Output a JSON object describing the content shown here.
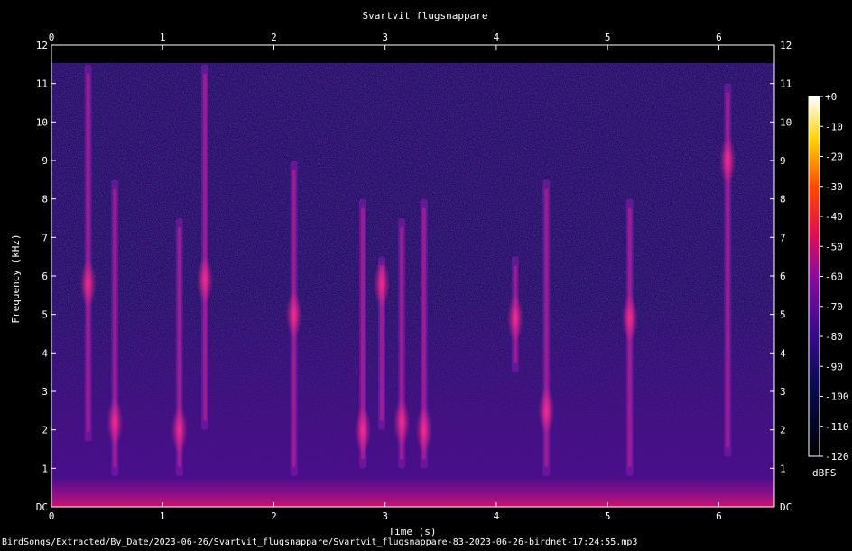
{
  "chart_data": {
    "type": "heatmap",
    "title": "Svartvit flugsnappare",
    "xlabel": "Time (s)",
    "ylabel": "Frequency (kHz)",
    "xlim": [
      0,
      6.5
    ],
    "ylim": [
      0,
      12
    ],
    "x_ticks": [
      "0",
      "1",
      "2",
      "3",
      "4",
      "5",
      "6"
    ],
    "y_ticks": [
      "DC",
      "1",
      "2",
      "3",
      "4",
      "5",
      "6",
      "7",
      "8",
      "9",
      "10",
      "11",
      "12"
    ],
    "colorbar": {
      "label": "dBFS",
      "range": [
        -120,
        0
      ],
      "ticks": [
        "+0",
        "-10",
        "-20",
        "-30",
        "-40",
        "-50",
        "-60",
        "-70",
        "-80",
        "-90",
        "-100",
        "-110",
        "-120"
      ]
    },
    "calls": [
      {
        "t": 0.33,
        "f_min": 1.7,
        "f_max": 11.5,
        "peak_khz": 5.8
      },
      {
        "t": 0.57,
        "f_min": 0.8,
        "f_max": 8.5,
        "peak_khz": 2.2
      },
      {
        "t": 1.15,
        "f_min": 0.8,
        "f_max": 7.5,
        "peak_khz": 2.0
      },
      {
        "t": 1.38,
        "f_min": 2.0,
        "f_max": 11.5,
        "peak_khz": 5.9
      },
      {
        "t": 2.18,
        "f_min": 0.8,
        "f_max": 9.0,
        "peak_khz": 5.0
      },
      {
        "t": 2.8,
        "f_min": 1.0,
        "f_max": 8.0,
        "peak_khz": 2.0
      },
      {
        "t": 2.97,
        "f_min": 2.0,
        "f_max": 6.5,
        "peak_khz": 5.8
      },
      {
        "t": 3.15,
        "f_min": 1.0,
        "f_max": 7.5,
        "peak_khz": 2.2
      },
      {
        "t": 3.35,
        "f_min": 1.0,
        "f_max": 8.0,
        "peak_khz": 2.0
      },
      {
        "t": 4.17,
        "f_min": 3.5,
        "f_max": 6.5,
        "peak_khz": 4.9
      },
      {
        "t": 4.45,
        "f_min": 0.8,
        "f_max": 8.5,
        "peak_khz": 2.5
      },
      {
        "t": 5.2,
        "f_min": 0.8,
        "f_max": 8.0,
        "peak_khz": 4.9
      },
      {
        "t": 6.08,
        "f_min": 1.3,
        "f_max": 11.0,
        "peak_khz": 9.0
      }
    ]
  },
  "footer": {
    "path": "BirdSongs/Extracted/By_Date/2023-06-26/Svartvit_flugsnappare/Svartvit_flugsnappare-83-2023-06-26-birdnet-17:24:55.mp3"
  }
}
